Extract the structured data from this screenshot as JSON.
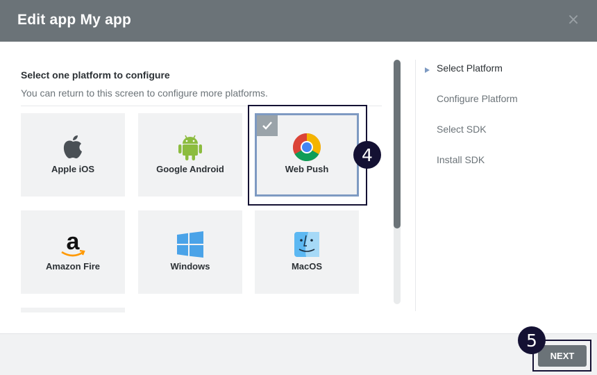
{
  "header": {
    "title": "Edit app My app",
    "close_symbol": "×"
  },
  "intro": {
    "title": "Select one platform to configure",
    "subtitle": "You can return to this screen to configure more platforms."
  },
  "platforms": [
    {
      "label": "Apple iOS",
      "icon": "apple-icon",
      "selected": false
    },
    {
      "label": "Google Android",
      "icon": "android-icon",
      "selected": false
    },
    {
      "label": "Web Push",
      "icon": "chrome-icon",
      "selected": true
    },
    {
      "label": "Amazon Fire",
      "icon": "amazon-icon",
      "selected": false
    },
    {
      "label": "Windows",
      "icon": "windows-icon",
      "selected": false
    },
    {
      "label": "MacOS",
      "icon": "finder-icon",
      "selected": false
    }
  ],
  "steps": [
    {
      "label": "Select Platform",
      "active": true
    },
    {
      "label": "Configure Platform",
      "active": false
    },
    {
      "label": "Select SDK",
      "active": false
    },
    {
      "label": "Install SDK",
      "active": false
    }
  ],
  "annotations": {
    "web_push_step": "4",
    "next_step": "5"
  },
  "footer": {
    "next_label": "NEXT"
  },
  "colors": {
    "header_bg": "#6b7378",
    "tile_bg": "#f1f2f3",
    "selected_border": "#7e9ac2",
    "annotation": "#141133",
    "next_button": "#6b7378"
  }
}
